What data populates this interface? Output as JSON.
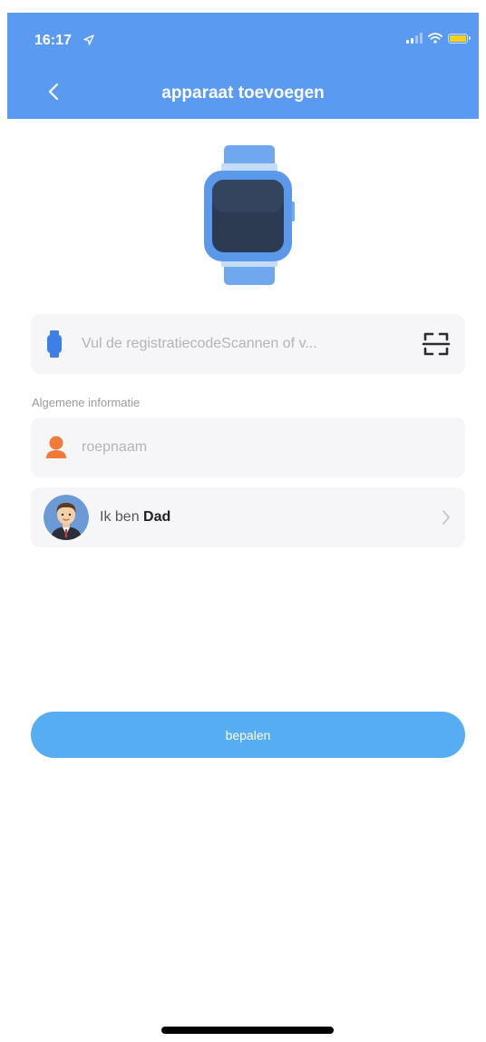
{
  "status_bar": {
    "time": "16:17"
  },
  "nav": {
    "title": "apparaat toevoegen",
    "back_icon": "chevron-left-icon"
  },
  "colors": {
    "header": "#5a9af0",
    "primary_button": "#56adf2",
    "row_bg": "#f6f6f8",
    "person_icon": "#ef7b3a",
    "watch_icon": "#3c7fe6"
  },
  "registration": {
    "icon": "watch-icon",
    "placeholder": "Vul de registratiecodeScannen of v...",
    "value": "",
    "scan_icon": "scan-icon"
  },
  "general_info": {
    "label": "Algemene informatie",
    "nickname": {
      "icon": "person-icon",
      "placeholder": "roepnaam",
      "value": ""
    },
    "relation": {
      "avatar": "dad-avatar",
      "prefix": "Ik ben",
      "value": "Dad",
      "chevron": "chevron-right-icon"
    }
  },
  "confirm": {
    "label": "bepalen"
  }
}
